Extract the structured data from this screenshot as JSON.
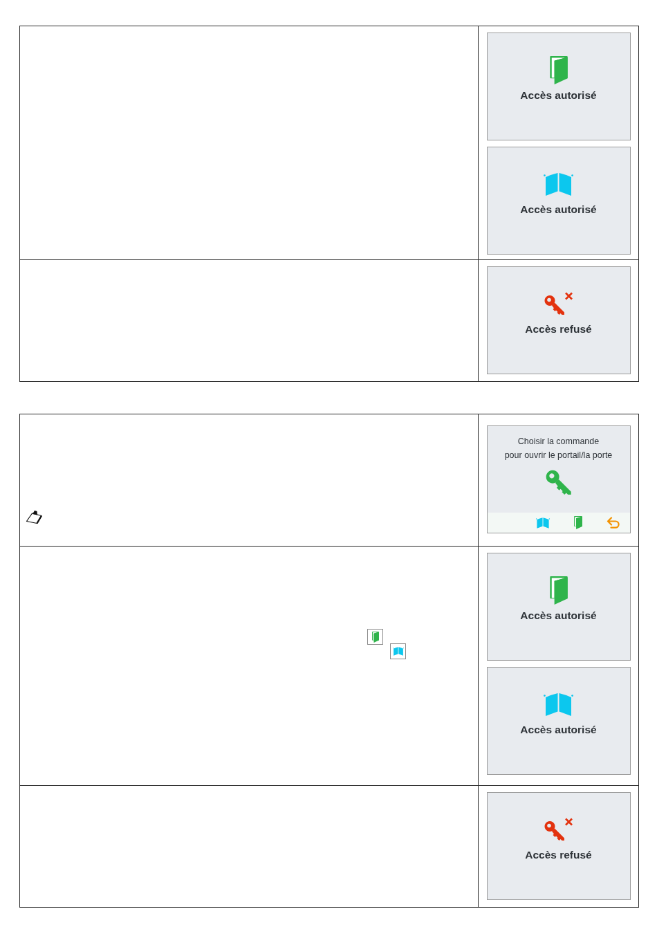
{
  "tables": [
    {
      "rows": [
        {
          "screens": [
            {
              "kind": "door",
              "message": "Accès autorisé"
            },
            {
              "kind": "gate",
              "message": "Accès autorisé"
            }
          ]
        },
        {
          "screens": [
            {
              "kind": "denied",
              "message": "Accès refusé"
            }
          ]
        }
      ]
    },
    {
      "rows": [
        {
          "note": true,
          "screens": [
            {
              "kind": "menu",
              "prompt_lines": [
                "Choisir la commande",
                "pour ouvrir le portail/la porte"
              ],
              "toolbar": [
                {
                  "kind": "gate"
                },
                {
                  "kind": "door"
                },
                {
                  "kind": "back"
                }
              ]
            }
          ]
        },
        {
          "marks": [
            {
              "kind": "door"
            },
            {
              "kind": "gate"
            }
          ],
          "screens": [
            {
              "kind": "door",
              "message": "Accès autorisé"
            },
            {
              "kind": "gate",
              "message": "Accès autorisé"
            }
          ]
        },
        {
          "screens": [
            {
              "kind": "denied",
              "message": "Accès refusé"
            }
          ]
        }
      ]
    }
  ]
}
